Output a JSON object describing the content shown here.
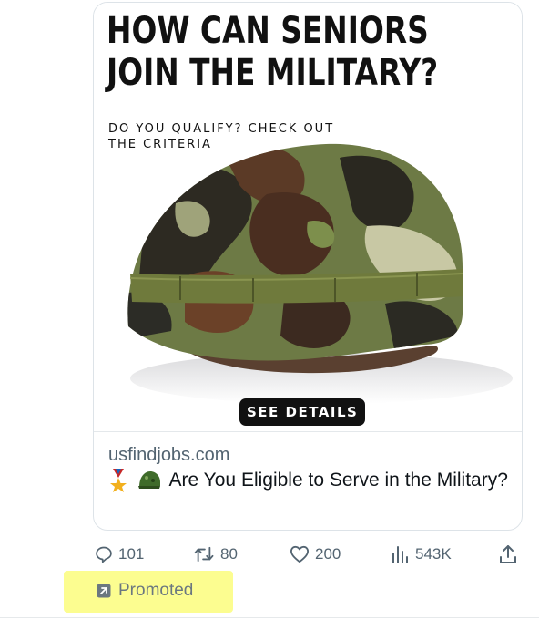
{
  "ad": {
    "headline_line1": "HOW CAN SENIORS",
    "headline_line2": "JOIN THE MILITARY?",
    "subheadline_line1": "DO YOU QUALIFY? CHECK OUT",
    "subheadline_line2": "THE CRITERIA",
    "cta_label": "SEE DETAILS",
    "image_subject": "camouflage military helmet"
  },
  "link": {
    "domain": "usfindjobs.com",
    "emojis": [
      "military-medal",
      "military-helmet"
    ],
    "title": "Are You Eligible to Serve in the Military?"
  },
  "actions": {
    "replies": "101",
    "reposts": "80",
    "likes": "200",
    "views": "543K"
  },
  "promoted_label": "Promoted",
  "colors": {
    "muted_text": "#536471",
    "highlight": "#fcfd90",
    "cta_background": "#111111"
  }
}
